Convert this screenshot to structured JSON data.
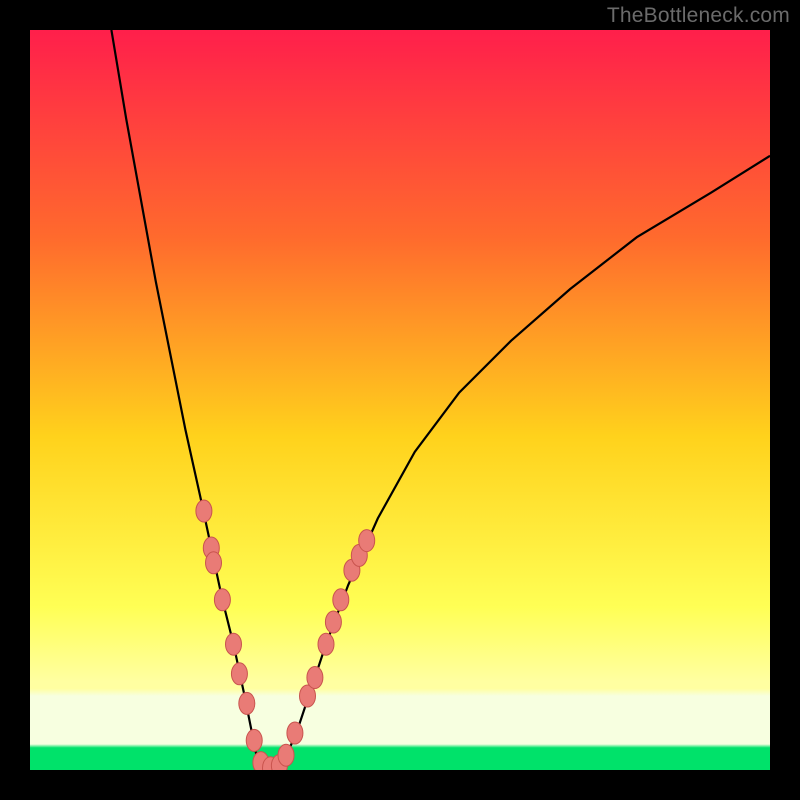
{
  "watermark": "TheBottleneck.com",
  "colors": {
    "frame": "#000000",
    "grad_top": "#ff1f4b",
    "grad_mid1": "#ff6a2d",
    "grad_mid2": "#ffd21c",
    "grad_mid3": "#ffff55",
    "grad_band_pale": "#ffffa1",
    "grad_bottom": "#00e26a",
    "curve": "#000000",
    "marker_fill": "#e97b76",
    "marker_stroke": "#c9544e"
  },
  "chart_data": {
    "type": "line",
    "title": "",
    "xlabel": "",
    "ylabel": "",
    "xlim": [
      0,
      100
    ],
    "ylim": [
      0,
      100
    ],
    "series": [
      {
        "name": "left-branch",
        "x": [
          11,
          13,
          15,
          17,
          19,
          21,
          23,
          24.5,
          26,
          27.5,
          29,
          30,
          30.8
        ],
        "y": [
          100,
          88,
          77,
          66,
          56,
          46,
          37,
          30,
          23,
          17,
          10,
          5,
          1
        ]
      },
      {
        "name": "valley",
        "x": [
          30.8,
          31.5,
          32.5,
          33.5,
          34.2
        ],
        "y": [
          1,
          0.4,
          0.2,
          0.4,
          1
        ]
      },
      {
        "name": "right-branch",
        "x": [
          34.2,
          36,
          38,
          40,
          43,
          47,
          52,
          58,
          65,
          73,
          82,
          92,
          100
        ],
        "y": [
          1,
          5,
          11,
          17,
          25,
          34,
          43,
          51,
          58,
          65,
          72,
          78,
          83
        ]
      }
    ],
    "markers": [
      {
        "x": 23.5,
        "y": 35
      },
      {
        "x": 24.5,
        "y": 30
      },
      {
        "x": 24.8,
        "y": 28
      },
      {
        "x": 26.0,
        "y": 23
      },
      {
        "x": 27.5,
        "y": 17
      },
      {
        "x": 28.3,
        "y": 13
      },
      {
        "x": 29.3,
        "y": 9
      },
      {
        "x": 30.3,
        "y": 4
      },
      {
        "x": 31.2,
        "y": 1
      },
      {
        "x": 32.5,
        "y": 0.3
      },
      {
        "x": 33.7,
        "y": 0.6
      },
      {
        "x": 34.6,
        "y": 2
      },
      {
        "x": 35.8,
        "y": 5
      },
      {
        "x": 37.5,
        "y": 10
      },
      {
        "x": 38.5,
        "y": 12.5
      },
      {
        "x": 40.0,
        "y": 17
      },
      {
        "x": 41.0,
        "y": 20
      },
      {
        "x": 42.0,
        "y": 23
      },
      {
        "x": 43.5,
        "y": 27
      },
      {
        "x": 44.5,
        "y": 29
      },
      {
        "x": 45.5,
        "y": 31
      }
    ]
  }
}
